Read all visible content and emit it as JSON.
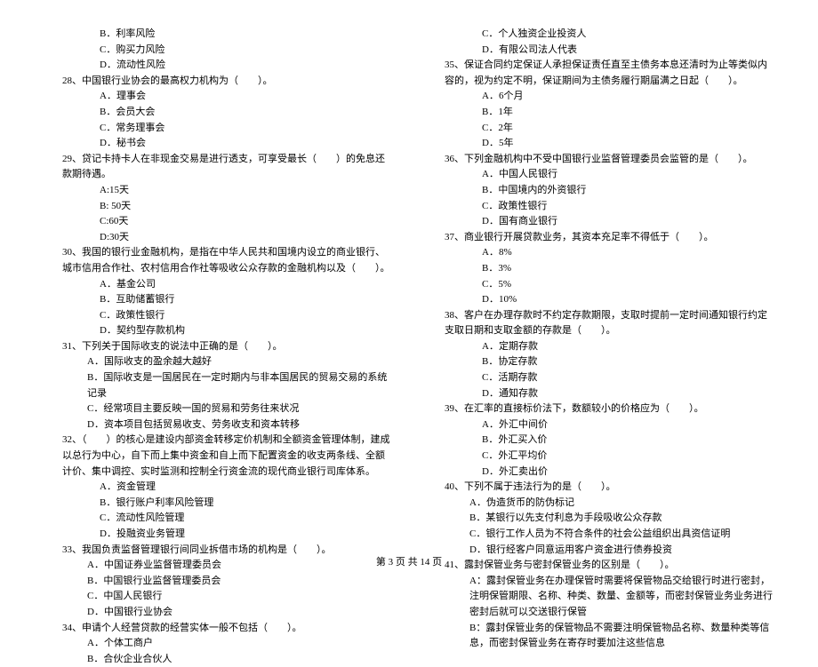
{
  "left": {
    "pre_options": [
      "B．利率风险",
      "C．购买力风险",
      "D．流动性风险"
    ],
    "q28": "28、中国银行业协会的最高权力机构为（　　）。",
    "q28_opts": [
      "A．理事会",
      "B．会员大会",
      "C．常务理事会",
      "D．秘书会"
    ],
    "q29": "29、贷记卡持卡人在非现金交易是进行透支，可享受最长（　　）的免息还款期待遇。",
    "q29_opts": [
      "A:15天",
      "B: 50天",
      "C:60天",
      "D:30天"
    ],
    "q30": "30、我国的银行业金融机构，是指在中华人民共和国境内设立的商业银行、城市信用合作社、农村信用合作社等吸收公众存款的金融机构以及（　　）。",
    "q30_opts": [
      "A．基金公司",
      "B．互助储蓄银行",
      "C．政策性银行",
      "D．契约型存款机构"
    ],
    "q31": "31、下列关于国际收支的说法中正确的是（　　）。",
    "q31_opts": [
      "A．国际收支的盈余越大越好",
      "B．国际收支是一国居民在一定时期内与非本国居民的贸易交易的系统记录",
      "C．经常项目主要反映一国的贸易和劳务往来状况",
      "D．资本项目包括贸易收支、劳务收支和资本转移"
    ],
    "q32": "32、（　　）的核心是建设内部资金转移定价机制和全额资金管理体制，建成以总行为中心，自下而上集中资金和自上而下配置资金的收支两条线、全额计价、集中调控、实时监测和控制全行资金流的现代商业银行司库体系。",
    "q32_opts": [
      "A．资金管理",
      "B．银行账户利率风险管理",
      "C．流动性风险管理",
      "D．投融资业务管理"
    ],
    "q33": "33、我国负责监督管理银行间同业拆借市场的机构是（　　）。",
    "q33_opts": [
      "A．中国证券业监督管理委员会",
      "B．中国银行业监督管理委员会",
      "C．中国人民银行",
      "D．中国银行业协会"
    ],
    "q34": "34、申请个人经营贷款的经营实体一般不包括（　　）。",
    "q34_opts": [
      "A．个体工商户",
      "B．合伙企业合伙人"
    ]
  },
  "right": {
    "pre_options": [
      "C．个人独资企业投资人",
      "D．有限公司法人代表"
    ],
    "q35": "35、保证合同约定保证人承担保证责任直至主债务本息还清时为止等类似内容的，视为约定不明，保证期间为主债务履行期届满之日起（　　）。",
    "q35_opts": [
      "A．6个月",
      "B．1年",
      "C．2年",
      "D．5年"
    ],
    "q36": "36、下列金融机构中不受中国银行业监督管理委员会监管的是（　　）。",
    "q36_opts": [
      "A．中国人民银行",
      "B．中国境内的外资银行",
      "C．政策性银行",
      "D．国有商业银行"
    ],
    "q37": "37、商业银行开展贷款业务，其资本充足率不得低于（　　）。",
    "q37_opts": [
      "A．8%",
      "B．3%",
      "C．5%",
      "D．10%"
    ],
    "q38": "38、客户在办理存款时不约定存款期限，支取时提前一定时间通知银行约定支取日期和支取金额的存款是（　　）。",
    "q38_opts": [
      "A．定期存款",
      "B．协定存款",
      "C．活期存款",
      "D．通知存款"
    ],
    "q39": "39、在汇率的直接标价法下，数额较小的价格应为（　　）。",
    "q39_opts": [
      "A．外汇中间价",
      "B．外汇买入价",
      "C．外汇平均价",
      "D．外汇卖出价"
    ],
    "q40": "40、下列不属于违法行为的是（　　）。",
    "q40_opts": [
      "A．伪造货币的防伪标记",
      "B．某银行以先支付利息为手段吸收公众存款",
      "C．银行工作人员为不符合条件的社会公益组织出具资信证明",
      "D．银行经客户同意运用客户资金进行债券投资"
    ],
    "q41": "41、露封保管业务与密封保管业务的区别是（　　）。",
    "q41_a": "A：露封保管业务在办理保管时需要将保管物品交给银行时进行密封，注明保管期限、名称、种类、数量、金额等，而密封保管业务业务进行密封后就可以交送银行保管",
    "q41_b": "B：露封保管业务的保管物品不需要注明保管物品名称、数量种类等信息，而密封保管业务在寄存时要加注这些信息"
  },
  "footer": "第 3 页 共 14 页"
}
